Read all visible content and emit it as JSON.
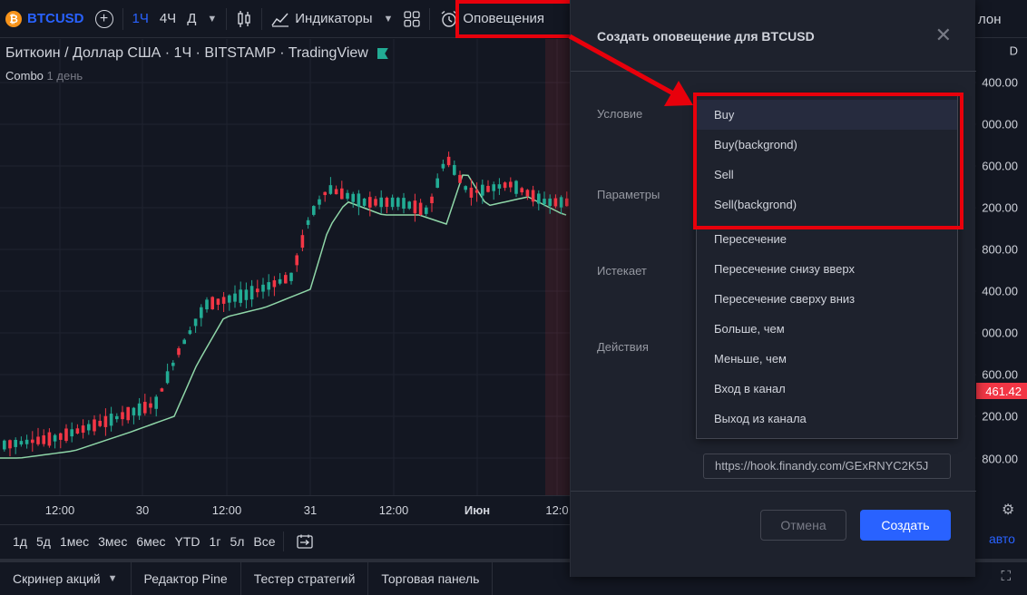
{
  "toolbar": {
    "symbol": "BTCUSD",
    "btc_glyph": "₿",
    "intervals": [
      "1Ч",
      "4Ч",
      "Д"
    ],
    "indicators": "Индикаторы",
    "alerts": "Оповещения",
    "right_fragment": "лон"
  },
  "legend": {
    "title": "Биткоин / Доллар США · 1Ч · BITSTAMP · TradingView",
    "combo": "Combo",
    "period": "1 день"
  },
  "time_axis": [
    "12:00",
    "30",
    "12:00",
    "31",
    "12:00",
    "Июн",
    "12:0"
  ],
  "range_buttons": [
    "1д",
    "5д",
    "1мес",
    "3мес",
    "6мес",
    "YTD",
    "1г",
    "5л",
    "Все"
  ],
  "bottom_tabs": [
    "Скринер акций",
    "Редактор Pine",
    "Тестер стратегий",
    "Торговая панель"
  ],
  "price_axis": {
    "currency_label": "D",
    "labels": [
      "400.00",
      "000.00",
      "600.00",
      "200.00",
      "800.00",
      "400.00",
      "000.00",
      "600.00",
      "200.00",
      "800.00"
    ],
    "current": "461.42",
    "auto": "авто"
  },
  "modal": {
    "title": "Создать оповещение для BTCUSD",
    "labels": {
      "condition": "Условие",
      "parameters": "Параметры",
      "expires": "Истекает",
      "actions": "Действия"
    },
    "webhook_url": "https://hook.finandy.com/GExRNYC2K5J",
    "cancel": "Отмена",
    "create": "Создать"
  },
  "dropdown": {
    "items": [
      "Buy",
      "Buy(backgrond)",
      "Sell",
      "Sell(backgrond)",
      "Пересечение",
      "Пересечение снизу вверх",
      "Пересечение сверху вниз",
      "Больше, чем",
      "Меньше, чем",
      "Вход в канал",
      "Выход из канала"
    ]
  },
  "colors": {
    "accent": "#2962ff",
    "up": "#22ab94",
    "down": "#f23645",
    "annotation": "#e8000b"
  }
}
